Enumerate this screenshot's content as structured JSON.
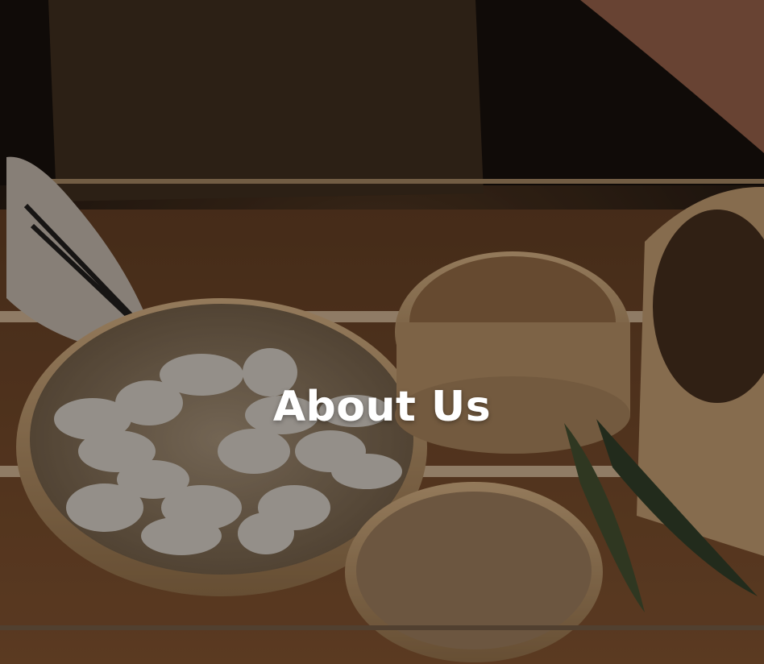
{
  "hero": {
    "title": "About Us"
  }
}
